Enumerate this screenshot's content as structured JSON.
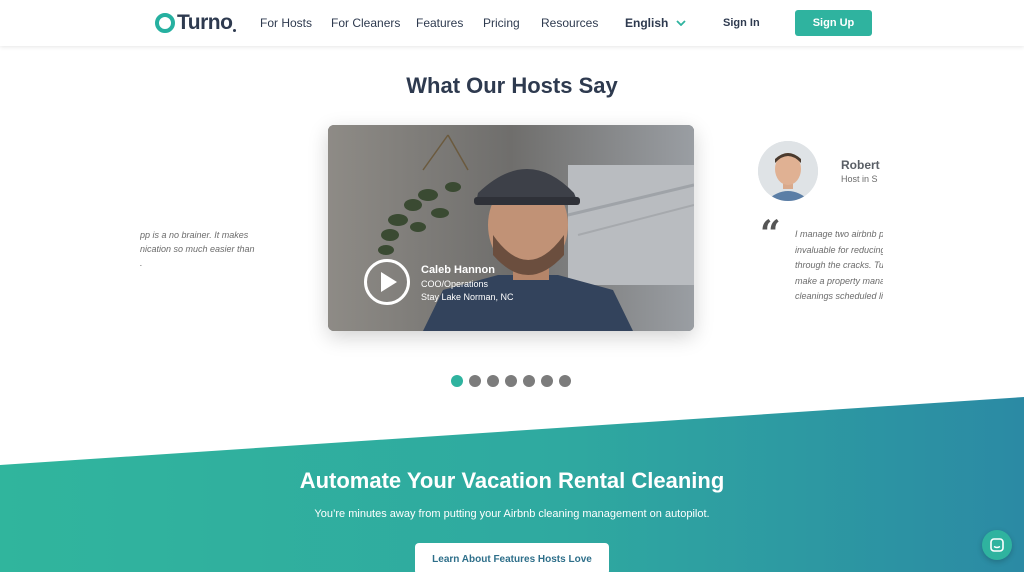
{
  "nav": {
    "logo_text": "Turno",
    "links": [
      "For Hosts",
      "For Cleaners",
      "Features",
      "Pricing",
      "Resources"
    ],
    "language": "English",
    "sign_in": "Sign In",
    "sign_up": "Sign Up"
  },
  "testimonials": {
    "title": "What Our Hosts Say",
    "left_quote_lines": [
      "pp is a no brainer. It makes",
      "nication so much easier than",
      "."
    ],
    "video": {
      "name": "Caleb Hannon",
      "role": "COO/Operations",
      "location": "Stay Lake Norman, NC"
    },
    "right": {
      "name": "Robert",
      "subtitle": "Host in S",
      "quote_mark": "“",
      "quote_lines": [
        "I manage two airbnb p",
        "invaluable for reducing",
        "through the cracks. Tu",
        "make a property mana",
        "cleanings scheduled lik"
      ]
    },
    "dot_count": 7,
    "active_dot": 0
  },
  "cta": {
    "title": "Automate Your Vacation Rental Cleaning",
    "subtitle": "You’re minutes away from putting your Airbnb cleaning management on autopilot.",
    "button": "Learn About Features Hosts Love"
  },
  "colors": {
    "brand": "#2fb39f",
    "navy": "#2e3a4f"
  },
  "icons": {
    "lang_chevron": "chevron-down-icon",
    "play": "play-icon",
    "chat": "chat-icon"
  }
}
